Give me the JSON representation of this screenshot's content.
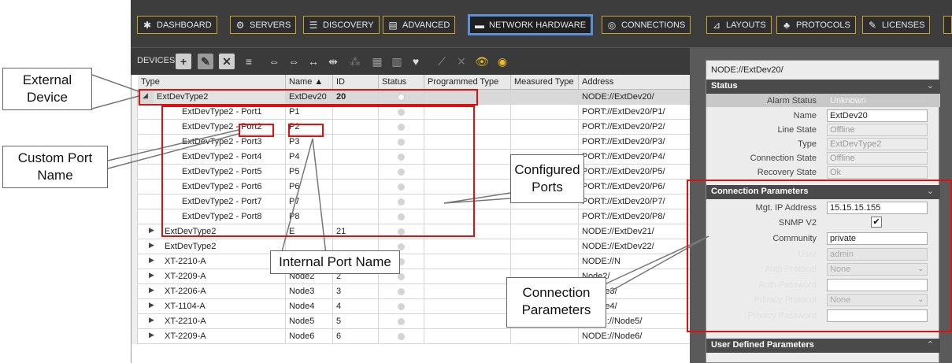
{
  "nav": [
    {
      "label": "DASHBOARD",
      "icon": "dashboard-icon"
    },
    {
      "label": "SERVERS",
      "icon": "gear-icon"
    },
    {
      "label": "DISCOVERY",
      "icon": "list-icon"
    },
    {
      "label": "ADVANCED",
      "icon": "document-icon"
    },
    {
      "label": "NETWORK HARDWARE",
      "icon": "network-icon"
    },
    {
      "label": "CONNECTIONS",
      "icon": "connections-icon"
    },
    {
      "label": "LAYOUTS",
      "icon": "layouts-icon"
    },
    {
      "label": "PROTOCOLS",
      "icon": "protocols-icon"
    },
    {
      "label": "LICENSES",
      "icon": "key-icon"
    }
  ],
  "toolbar": {
    "label": "DEVICES"
  },
  "columns": [
    "Type",
    "Name",
    "ID",
    "Status",
    "Programmed Type",
    "Measured Type",
    "Address"
  ],
  "rows": [
    {
      "type": "ExtDevType2",
      "name": "ExtDev20",
      "id": "20",
      "address": "NODE://ExtDev20/",
      "level": 0,
      "expanded": true
    },
    {
      "type": "ExtDevType2 - Port1",
      "name": "P1",
      "id": "",
      "address": "PORT://ExtDev20/P1/",
      "level": 1
    },
    {
      "type": "ExtDevType2 - Port2",
      "name": "P2",
      "id": "",
      "address": "PORT://ExtDev20/P2/",
      "level": 1
    },
    {
      "type": "ExtDevType2 - Port3",
      "name": "P3",
      "id": "",
      "address": "PORT://ExtDev20/P3/",
      "level": 1
    },
    {
      "type": "ExtDevType2 - Port4",
      "name": "P4",
      "id": "",
      "address": "PORT://ExtDev20/P4/",
      "level": 1
    },
    {
      "type": "ExtDevType2 - Port5",
      "name": "P5",
      "id": "",
      "address": "PORT://ExtDev20/P5/",
      "level": 1
    },
    {
      "type": "ExtDevType2 - Port6",
      "name": "P6",
      "id": "",
      "address": "PORT://ExtDev20/P6/",
      "level": 1
    },
    {
      "type": "ExtDevType2 - Port7",
      "name": "P7",
      "id": "",
      "address": "PORT://ExtDev20/P7/",
      "level": 1
    },
    {
      "type": "ExtDevType2 - Port8",
      "name": "P8",
      "id": "",
      "address": "PORT://ExtDev20/P8/",
      "level": 1
    },
    {
      "type": "ExtDevType2",
      "name": "E",
      "id": "21",
      "address": "NODE://ExtDev21/",
      "level": 0
    },
    {
      "type": "ExtDevType2",
      "name": "",
      "id": "",
      "address": "NODE://ExtDev22/",
      "level": 0
    },
    {
      "type": "XT-2210-A",
      "name": "Node1",
      "id": "",
      "address": "NODE://N",
      "level": 0
    },
    {
      "type": "XT-2209-A",
      "name": "Node2",
      "id": "2",
      "address": "Node2/",
      "level": 0
    },
    {
      "type": "XT-2206-A",
      "name": "Node3",
      "id": "3",
      "address": "://Node3/",
      "level": 0
    },
    {
      "type": "XT-1104-A",
      "name": "Node4",
      "id": "4",
      "address": "://Node4/",
      "level": 0
    },
    {
      "type": "XT-2210-A",
      "name": "Node5",
      "id": "5",
      "address": "NODE://Node5/",
      "level": 0
    },
    {
      "type": "XT-2209-A",
      "name": "Node6",
      "id": "6",
      "address": "NODE://Node6/",
      "level": 0
    }
  ],
  "panel": {
    "title": "NODE://ExtDev20/",
    "status_section": "Status",
    "status_fields": [
      {
        "label": "Alarm Status",
        "value": "Unknown"
      },
      {
        "label": "Name",
        "value": "ExtDev20"
      },
      {
        "label": "Line State",
        "value": "Offline"
      },
      {
        "label": "Type",
        "value": "ExtDevType2"
      },
      {
        "label": "Connection State",
        "value": "Offline"
      },
      {
        "label": "Recovery State",
        "value": "Ok"
      }
    ],
    "conn_section": "Connection Parameters",
    "conn_fields": [
      {
        "label": "Mgt. IP Address",
        "value": "15.15.15.155"
      },
      {
        "label": "SNMP V2",
        "value": "✔"
      },
      {
        "label": "Community",
        "value": "private"
      },
      {
        "label": "User",
        "value": "admin"
      },
      {
        "label": "Auth Protocol",
        "value": "None"
      },
      {
        "label": "Auth Password",
        "value": ""
      },
      {
        "label": "Privacy Protocol",
        "value": "None"
      },
      {
        "label": "Privacy Password",
        "value": ""
      }
    ],
    "user_section": "User Defined Parameters"
  },
  "annotations": {
    "external_device": "External Device",
    "custom_port_name": "Custom Port Name",
    "configured_ports": "Configured Ports",
    "internal_port_name": "Internal Port Name",
    "connection_parameters": "Connection Parameters"
  },
  "colors": {
    "highlight": "#e01010",
    "active_nav": "#5b8fd6",
    "nav_border": "#c9a227"
  }
}
